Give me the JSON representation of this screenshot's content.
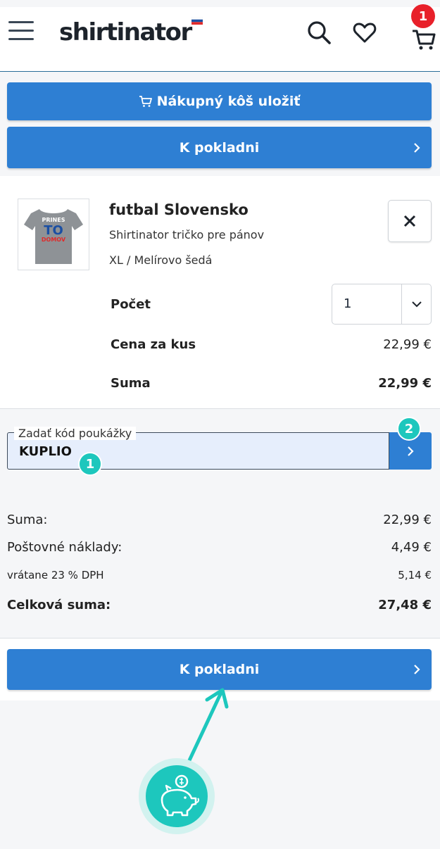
{
  "header": {
    "logo_text": "shirtinator",
    "cart_count": "1"
  },
  "buttons": {
    "save_cart_label": "Nákupný kôš uložiť",
    "checkout_label": "K pokladni",
    "checkout_bottom_label": "K pokladni"
  },
  "product": {
    "title": "futbal Slovensko",
    "subtitle": "Shirtinator tričko pre pánov",
    "variant": "XL / Melírovo šedá",
    "shirt_text_top": "PRINES",
    "shirt_text_mid": "TO",
    "shirt_text_bottom": "DOMOV",
    "quantity_label": "Počet",
    "quantity_value": "1",
    "unit_price_label": "Cena za kus",
    "unit_price_value": "22,99 €",
    "sum_label": "Suma",
    "sum_value": "22,99 €"
  },
  "voucher": {
    "label": "Zadať kód poukážky",
    "value": "KUPLIO",
    "step1": "1",
    "step2": "2"
  },
  "summary": {
    "subtotal_label": "Suma:",
    "subtotal_value": "22,99 €",
    "shipping_label": "Poštovné náklady:",
    "shipping_value": "4,49 €",
    "vat_label": "vrátane 23 % DPH",
    "vat_value": "5,14 €",
    "total_label": "Celková suma:",
    "total_value": "27,48 €"
  },
  "colors": {
    "primary_blue": "#2e7fd3",
    "teal_accent": "#1dc7bd",
    "badge_red": "#e8202a"
  }
}
